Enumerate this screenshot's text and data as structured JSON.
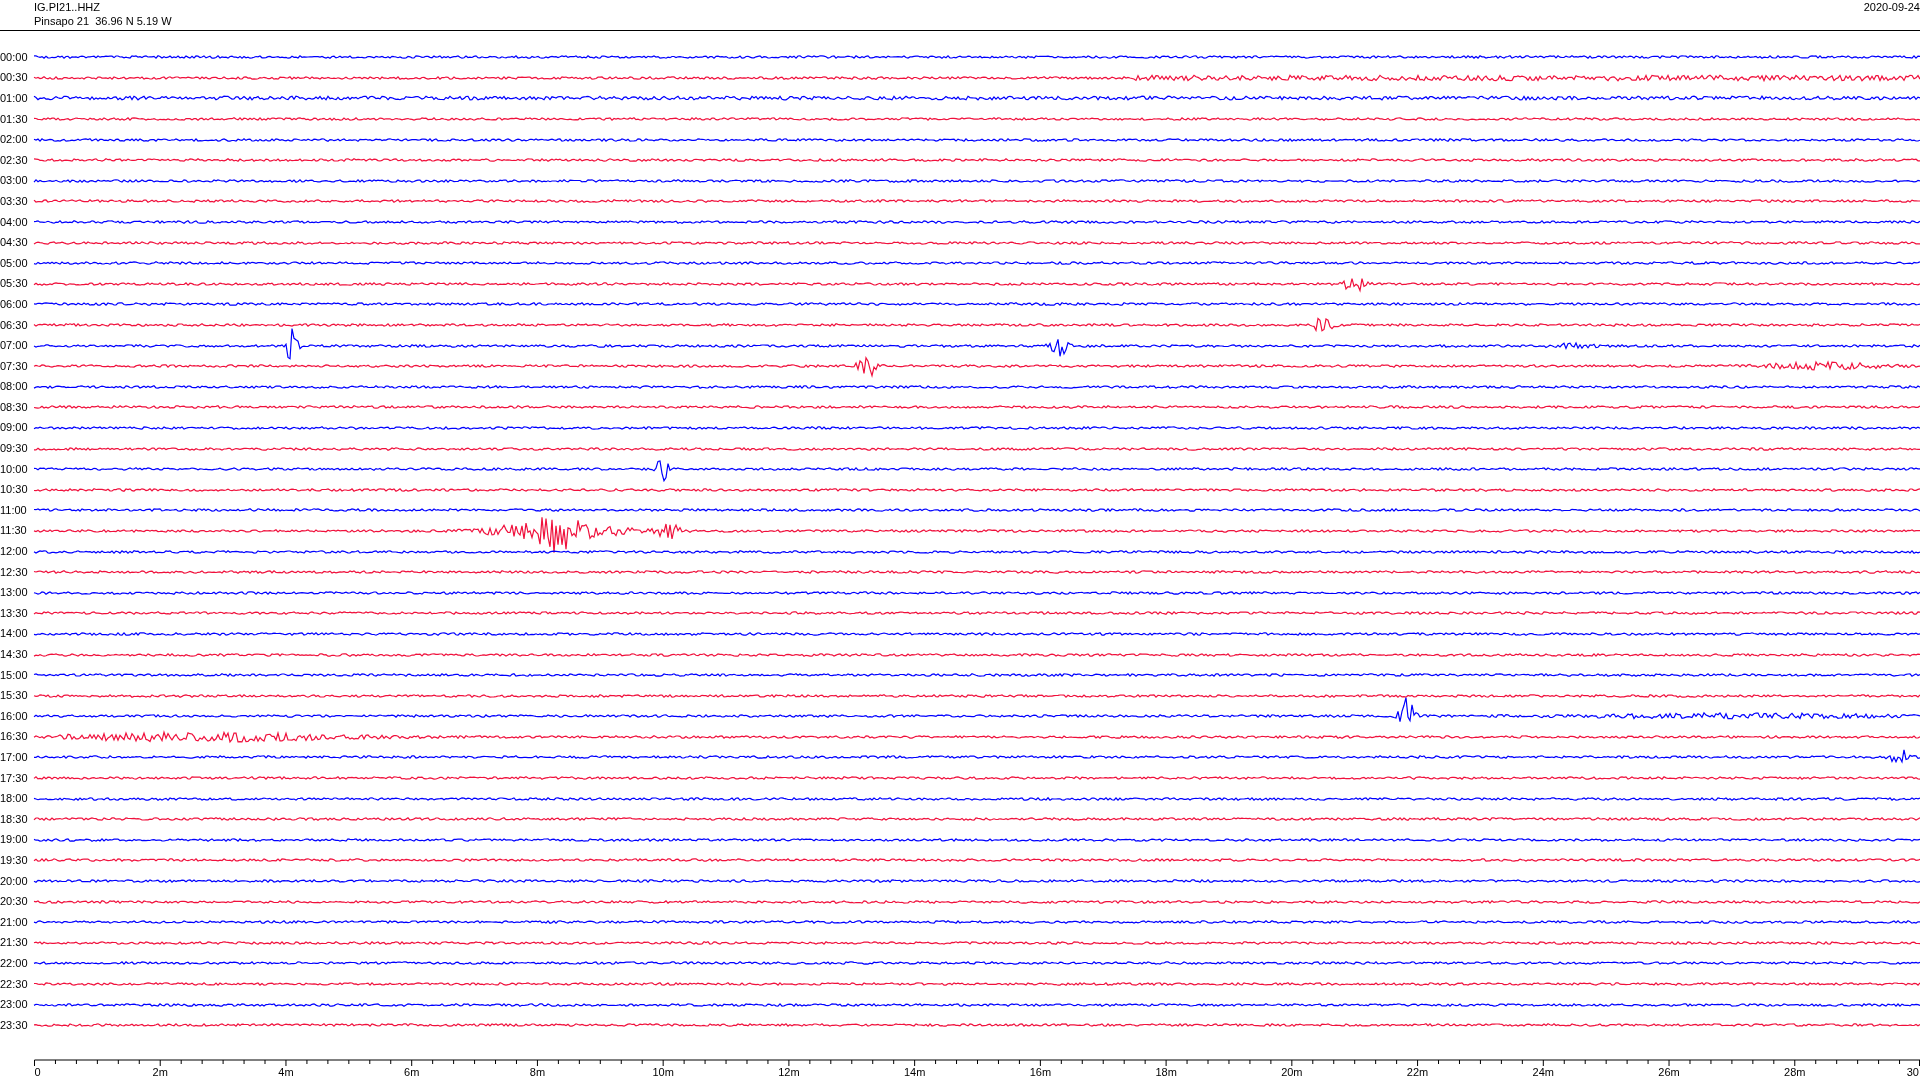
{
  "header": {
    "channel": "IG.PI21..HHZ",
    "station": "Pinsapo 21  36.96 N 5.19 W",
    "date": "2020-09-24"
  },
  "rows": [
    {
      "label": "00:00",
      "color": "#0000ff"
    },
    {
      "label": "00:30",
      "color": "#f0103c"
    },
    {
      "label": "01:00",
      "color": "#0000ff"
    },
    {
      "label": "01:30",
      "color": "#f0103c"
    },
    {
      "label": "02:00",
      "color": "#0000ff"
    },
    {
      "label": "02:30",
      "color": "#f0103c"
    },
    {
      "label": "03:00",
      "color": "#0000ff"
    },
    {
      "label": "03:30",
      "color": "#f0103c"
    },
    {
      "label": "04:00",
      "color": "#0000ff"
    },
    {
      "label": "04:30",
      "color": "#f0103c"
    },
    {
      "label": "05:00",
      "color": "#0000ff"
    },
    {
      "label": "05:30",
      "color": "#f0103c"
    },
    {
      "label": "06:00",
      "color": "#0000ff"
    },
    {
      "label": "06:30",
      "color": "#f0103c"
    },
    {
      "label": "07:00",
      "color": "#0000ff"
    },
    {
      "label": "07:30",
      "color": "#f0103c"
    },
    {
      "label": "08:00",
      "color": "#0000ff"
    },
    {
      "label": "08:30",
      "color": "#f0103c"
    },
    {
      "label": "09:00",
      "color": "#0000ff"
    },
    {
      "label": "09:30",
      "color": "#f0103c"
    },
    {
      "label": "10:00",
      "color": "#0000ff"
    },
    {
      "label": "10:30",
      "color": "#f0103c"
    },
    {
      "label": "11:00",
      "color": "#0000ff"
    },
    {
      "label": "11:30",
      "color": "#f0103c"
    },
    {
      "label": "12:00",
      "color": "#0000ff"
    },
    {
      "label": "12:30",
      "color": "#f0103c"
    },
    {
      "label": "13:00",
      "color": "#0000ff"
    },
    {
      "label": "13:30",
      "color": "#f0103c"
    },
    {
      "label": "14:00",
      "color": "#0000ff"
    },
    {
      "label": "14:30",
      "color": "#f0103c"
    },
    {
      "label": "15:00",
      "color": "#0000ff"
    },
    {
      "label": "15:30",
      "color": "#f0103c"
    },
    {
      "label": "16:00",
      "color": "#0000ff"
    },
    {
      "label": "16:30",
      "color": "#f0103c"
    },
    {
      "label": "17:00",
      "color": "#0000ff"
    },
    {
      "label": "17:30",
      "color": "#f0103c"
    },
    {
      "label": "18:00",
      "color": "#0000ff"
    },
    {
      "label": "18:30",
      "color": "#f0103c"
    },
    {
      "label": "19:00",
      "color": "#0000ff"
    },
    {
      "label": "19:30",
      "color": "#f0103c"
    },
    {
      "label": "20:00",
      "color": "#0000ff"
    },
    {
      "label": "20:30",
      "color": "#f0103c"
    },
    {
      "label": "21:00",
      "color": "#0000ff"
    },
    {
      "label": "21:30",
      "color": "#f0103c"
    },
    {
      "label": "22:00",
      "color": "#0000ff"
    },
    {
      "label": "22:30",
      "color": "#f0103c"
    },
    {
      "label": "23:00",
      "color": "#0000ff"
    },
    {
      "label": "23:30",
      "color": "#f0103c"
    }
  ],
  "time_axis": {
    "labels": [
      "0",
      "2m",
      "4m",
      "6m",
      "8m",
      "10m",
      "12m",
      "14m",
      "16m",
      "18m",
      "20m",
      "22m",
      "24m",
      "26m",
      "28m",
      "30"
    ]
  }
}
